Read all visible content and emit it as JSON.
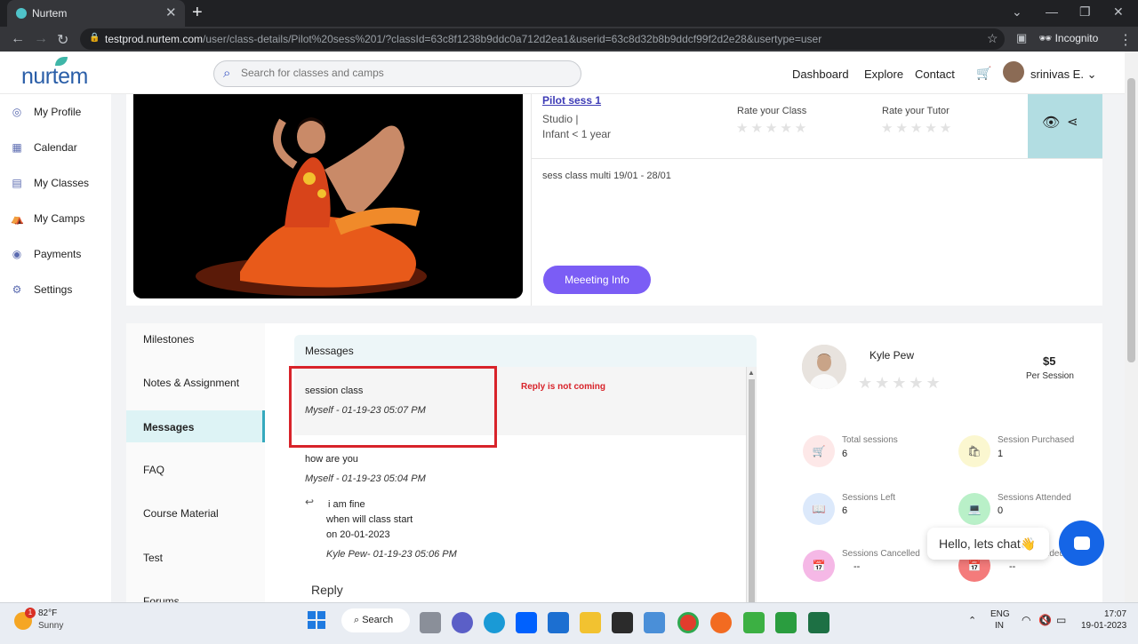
{
  "browser": {
    "tab_title": "Nurtem",
    "url_host": "testprod.nurtem.com",
    "url_path": "/user/class-details/Pilot%20sess%201/?classId=63c8f1238b9ddc0a712d2ea1&userid=63c8d32b8b9ddcf99f2d2e28&usertype=user",
    "incognito_label": "Incognito"
  },
  "header": {
    "logo": "nurtem",
    "search_placeholder": "Search for classes and camps",
    "links": [
      "Dashboard",
      "Explore",
      "Contact"
    ],
    "user_name": "srinivas E."
  },
  "sidebar": {
    "items": [
      {
        "label": "My Profile",
        "icon": "profile-icon"
      },
      {
        "label": "Calendar",
        "icon": "calendar-icon"
      },
      {
        "label": "My Classes",
        "icon": "classes-icon"
      },
      {
        "label": "My Camps",
        "icon": "camps-icon"
      },
      {
        "label": "Payments",
        "icon": "payments-icon"
      },
      {
        "label": "Settings",
        "icon": "settings-icon"
      }
    ]
  },
  "class": {
    "title": "Pilot sess 1",
    "type": "Studio |",
    "age": "Infant < 1 year",
    "rate_class_label": "Rate your Class",
    "rate_tutor_label": "Rate your Tutor",
    "stars": "★★★★★",
    "description": "sess class multi 19/01 - 28/01",
    "meeting_button": "Meeeting Info"
  },
  "tabs": {
    "items": [
      "Milestones",
      "Notes & Assignment",
      "Messages",
      "FAQ",
      "Course Material",
      "Test",
      "Forums"
    ],
    "active": "Messages"
  },
  "messages": {
    "header": "Messages",
    "annotation": "Reply is not coming",
    "list": [
      {
        "text": "session class",
        "meta": "Myself - 01-19-23 05:07 PM"
      },
      {
        "text": "how are you",
        "meta": "Myself - 01-19-23 05:04 PM"
      }
    ],
    "reply": {
      "lines": [
        "i am fine",
        "when will class start",
        "on 20-01-2023"
      ],
      "meta": "Kyle Pew- 01-19-23 05:06 PM"
    },
    "reply_button": "Reply"
  },
  "tutor": {
    "name": "Kyle Pew",
    "price": "$5",
    "price_unit": "Per Session",
    "stats": [
      {
        "label": "Total sessions",
        "value": "6",
        "color": "#fde8e8",
        "icon_color": "#c62828",
        "glyph": "🛒"
      },
      {
        "label": "Session Purchased",
        "value": "1",
        "color": "#fbf7d0",
        "icon_color": "#555",
        "glyph": "🛍"
      },
      {
        "label": "Sessions Left",
        "value": "6",
        "color": "#dce9fb",
        "icon_color": "#2a5ea8",
        "glyph": "📖"
      },
      {
        "label": "Sessions Attended",
        "value": "0",
        "color": "#b9f0c8",
        "icon_color": "#1e7b3c",
        "glyph": "💻"
      },
      {
        "label": "Sessions Cancelled",
        "value": "--",
        "color": "#f5b8e6",
        "icon_color": "#6b2561",
        "glyph": "📅"
      },
      {
        "label": "...ded",
        "value": "--",
        "color": "#f47b7b",
        "icon_color": "#6b1a1a",
        "glyph": "📅"
      }
    ]
  },
  "chat": {
    "bubble": "Hello, lets chat👋"
  },
  "taskbar": {
    "weather_temp": "82°F",
    "weather_desc": "Sunny",
    "weather_badge": "1",
    "search_label": "Search",
    "lang_line1": "ENG",
    "lang_line2": "IN",
    "time": "17:07",
    "date": "19-01-2023"
  }
}
